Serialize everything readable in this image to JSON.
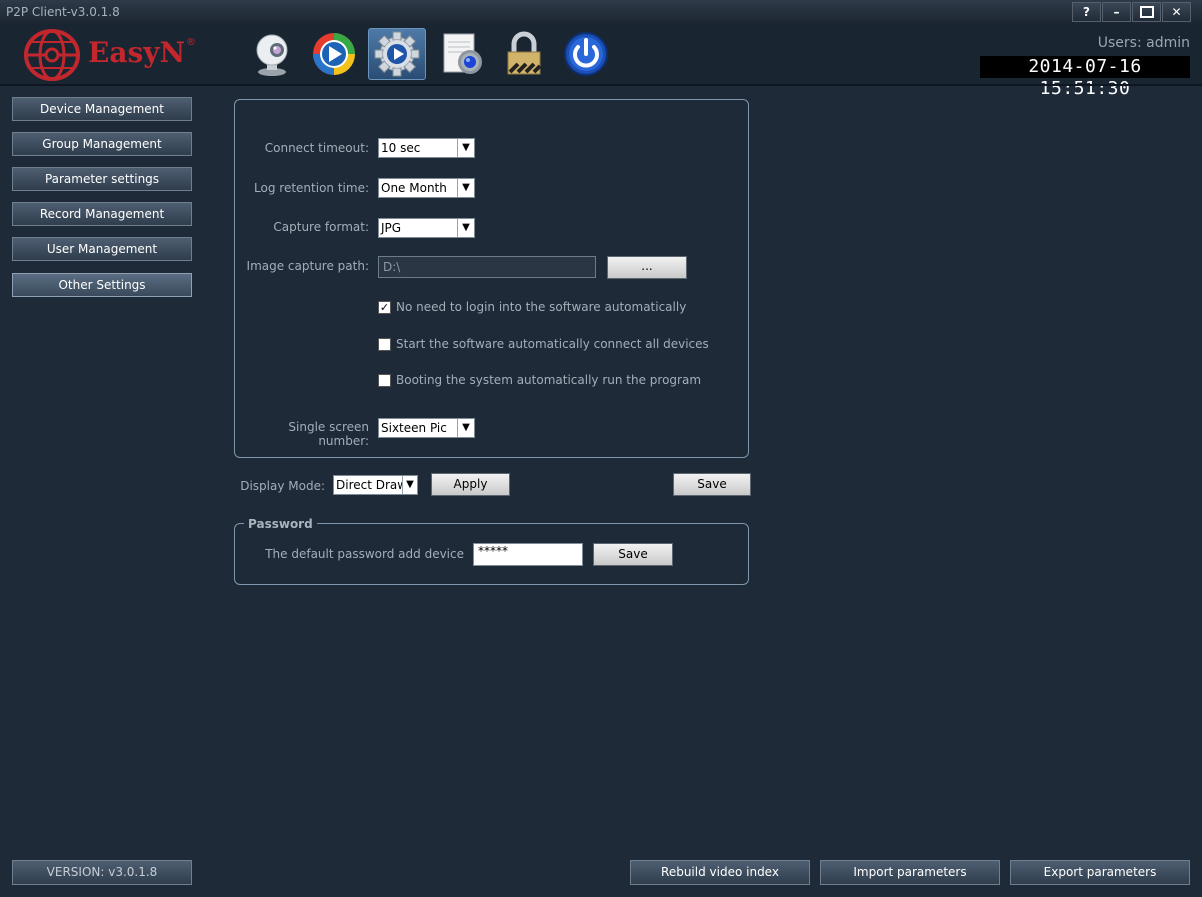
{
  "window": {
    "title": "P2P Client-v3.0.1.8",
    "controls": {
      "help": "?",
      "minimize": "–",
      "maximize": "□",
      "close": "✕"
    }
  },
  "header": {
    "logo_text": "EasyN",
    "logo_reg": "®",
    "users_label": "Users: admin",
    "datetime": "2014-07-16 15:51:30",
    "toolbar": [
      {
        "icon": "camera-icon"
      },
      {
        "icon": "playback-icon"
      },
      {
        "icon": "settings-gear-icon",
        "active": true
      },
      {
        "icon": "log-document-icon"
      },
      {
        "icon": "lock-icon"
      },
      {
        "icon": "power-icon"
      }
    ]
  },
  "nav": {
    "items": [
      {
        "label": "Device Management"
      },
      {
        "label": "Group Management"
      },
      {
        "label": "Parameter settings"
      },
      {
        "label": "Record Management"
      },
      {
        "label": "User Management"
      },
      {
        "label": "Other Settings",
        "selected": true
      }
    ],
    "version": "VERSION: v3.0.1.8"
  },
  "settings": {
    "connect_timeout": {
      "label": "Connect timeout:",
      "value": "10 sec"
    },
    "log_retention": {
      "label": "Log retention time:",
      "value": "One Month"
    },
    "capture_format": {
      "label": "Capture format:",
      "value": "JPG"
    },
    "capture_path": {
      "label": "Image capture path:",
      "value": "D:\\",
      "browse_label": "..."
    },
    "checkboxes": [
      {
        "label": "No need to login into the software automatically",
        "checked": true
      },
      {
        "label": "Start the software automatically connect all devices",
        "checked": false
      },
      {
        "label": "Booting the system automatically run the program",
        "checked": false
      }
    ],
    "screen_number": {
      "label": "Single screen number:",
      "value": "Sixteen Pic"
    },
    "display_mode": {
      "label": "Display Mode:",
      "value": "Direct Draw"
    },
    "apply_label": "Apply",
    "save_label": "Save"
  },
  "password": {
    "legend": "Password",
    "label": "The default password add device",
    "value": "*****",
    "save_label": "Save"
  },
  "footer": {
    "rebuild_label": "Rebuild video index",
    "import_label": "Import parameters",
    "export_label": "Export parameters"
  },
  "colors": {
    "background": "#1e2a38",
    "brand_red": "#c1272d",
    "panel_border": "#7e97ab"
  }
}
